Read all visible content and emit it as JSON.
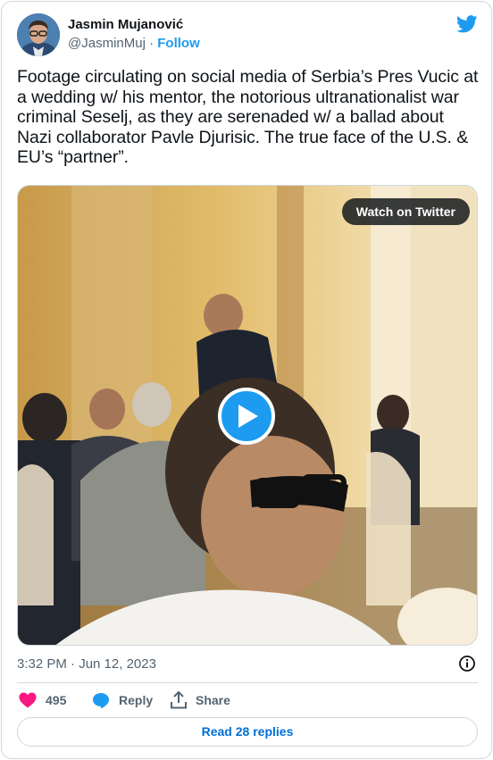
{
  "author": {
    "name": "Jasmin Mujanović",
    "handle": "@JasminMuj",
    "separator": "·",
    "follow_label": "Follow"
  },
  "tweet": {
    "text": "Footage circulating on social media of Serbia’s Pres Vucic at a wedding w/ his mentor, the notorious ultranationalist war criminal Seselj, as they are serenaded w/ a ballad about Nazi collaborator Pavle Djurisic. The true face of the U.S. & EU’s “partner”.",
    "timestamp": "3:32 PM · Jun 12, 2023"
  },
  "media": {
    "watch_label": "Watch on Twitter"
  },
  "actions": {
    "like_count": "495",
    "reply_label": "Reply",
    "share_label": "Share",
    "read_replies_label": "Read 28 replies"
  },
  "colors": {
    "accent": "#1d9bf0",
    "like": "#f91880",
    "muted": "#536471"
  },
  "icons": [
    "twitter-bird-icon",
    "play-icon",
    "info-icon",
    "heart-icon",
    "reply-bubble-icon",
    "share-icon"
  ]
}
